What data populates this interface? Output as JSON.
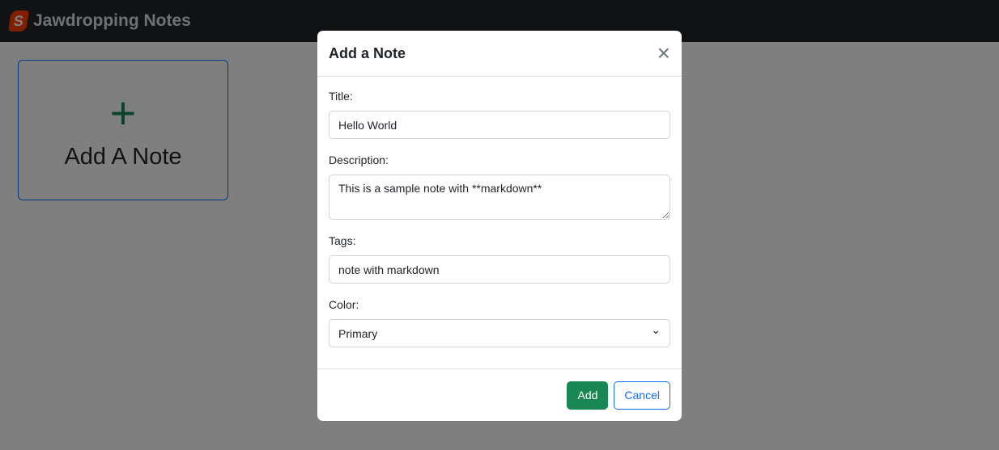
{
  "navbar": {
    "brand": "Jawdropping Notes",
    "logo_letter": "S"
  },
  "card": {
    "plus": "+",
    "label": "Add A Note"
  },
  "modal": {
    "title": "Add a Note",
    "close": "×",
    "title_label": "Title:",
    "title_value": "Hello World",
    "description_label": "Description:",
    "description_value": "This is a sample note with **markdown**",
    "tags_label": "Tags:",
    "tags_value": "note with markdown",
    "color_label": "Color:",
    "color_value": "Primary",
    "chevron": "⌄",
    "add": "Add",
    "cancel": "Cancel"
  }
}
